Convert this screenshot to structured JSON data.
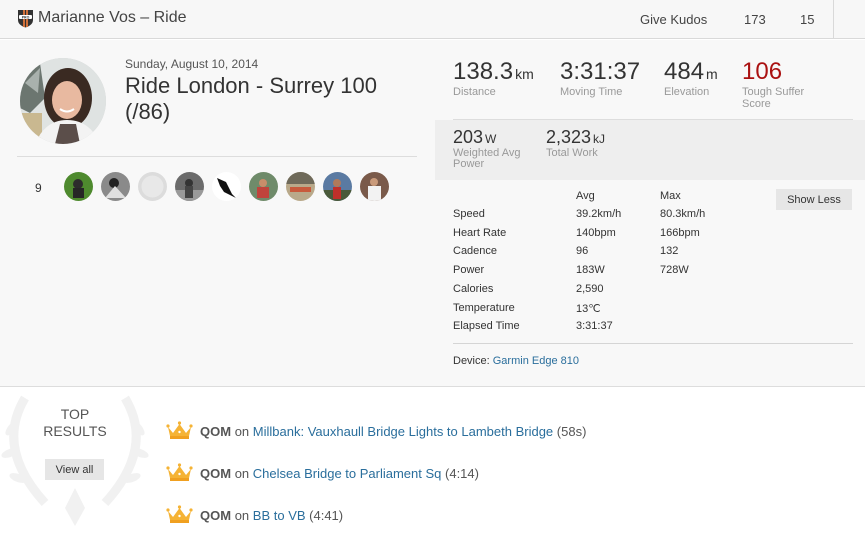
{
  "header": {
    "badge_icon": "pro-badge-icon",
    "title": "Marianne Vos – Ride",
    "give_kudos": "Give Kudos",
    "kudos_count": "173",
    "comment_count": "15"
  },
  "activity": {
    "date": "Sunday, August 10, 2014",
    "title": "Ride London - Surrey 100 (/86)",
    "athletes_count": "9",
    "athlete_avatars": [
      "athlete-1",
      "athlete-2",
      "athlete-3",
      "athlete-4",
      "athlete-5",
      "athlete-6",
      "athlete-7",
      "athlete-8",
      "athlete-9"
    ]
  },
  "stats": {
    "distance": {
      "value": "138.3",
      "unit": "km",
      "label": "Distance"
    },
    "moving_time": {
      "value": "3:31:37",
      "unit": "",
      "label": "Moving Time"
    },
    "elevation": {
      "value": "484",
      "unit": "m",
      "label": "Elevation"
    },
    "suffer": {
      "value": "106",
      "label_line1": "Tough Suffer",
      "label_line2": "Score",
      "color": "#aa1111"
    },
    "weighted_power": {
      "value": "203",
      "unit": "W",
      "label_line1": "Weighted Avg",
      "label_line2": "Power"
    },
    "total_work": {
      "value": "2,323",
      "unit": "kJ",
      "label": "Total Work"
    }
  },
  "details": {
    "col_avg": "Avg",
    "col_max": "Max",
    "show_less": "Show Less",
    "rows": [
      {
        "label": "Speed",
        "avg": "39.2km/h",
        "max": "80.3km/h"
      },
      {
        "label": "Heart Rate",
        "avg": "140bpm",
        "max": "166bpm"
      },
      {
        "label": "Cadence",
        "avg": "96",
        "max": "132"
      },
      {
        "label": "Power",
        "avg": "183W",
        "max": "728W"
      },
      {
        "label": "Calories",
        "avg": "2,590",
        "max": ""
      },
      {
        "label": "Temperature",
        "avg": "13℃",
        "max": ""
      },
      {
        "label": "Elapsed Time",
        "avg": "3:31:37",
        "max": ""
      }
    ],
    "device_label": "Device:",
    "device_name": "Garmin Edge 810"
  },
  "top_results": {
    "title_line1": "TOP",
    "title_line2": "RESULTS",
    "view_all": "View all",
    "items": [
      {
        "icon": "crown-icon",
        "achievement": "QOM",
        "on": "on",
        "segment": "Millbank: Vauxhaull Bridge Lights to Lambeth Bridge",
        "time": "(58s)"
      },
      {
        "icon": "crown-icon",
        "achievement": "QOM",
        "on": "on",
        "segment": "Chelsea Bridge to Parliament Sq",
        "time": "(4:14)"
      },
      {
        "icon": "crown-icon",
        "achievement": "QOM",
        "on": "on",
        "segment": "BB to VB",
        "time": "(4:41)"
      }
    ]
  },
  "colors": {
    "link": "#2a6e9c",
    "suffer": "#aa1111",
    "crown": "#f5b335"
  }
}
